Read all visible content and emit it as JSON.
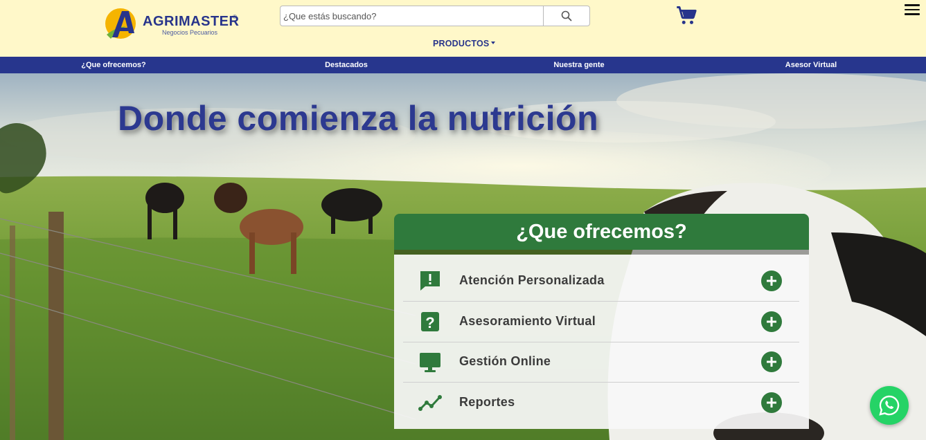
{
  "header": {
    "logo_text": "AGRIMASTER",
    "logo_registered": "®",
    "logo_sub": "Negocios Pecuarios",
    "search_placeholder": "¿Que estás buscando?",
    "productos_label": "PRODUCTOS"
  },
  "nav": {
    "items": [
      {
        "label": "¿Que ofrecemos?"
      },
      {
        "label": "Destacados"
      },
      {
        "label": "Nuestra gente"
      },
      {
        "label": "Asesor Virtual"
      }
    ]
  },
  "hero": {
    "title": "Donde comienza la nutrición"
  },
  "offer": {
    "title": "¿Que ofrecemos?",
    "items": [
      {
        "label": "Atención Personalizada",
        "icon": "chat-alert-icon"
      },
      {
        "label": "Asesoramiento Virtual",
        "icon": "question-square-icon"
      },
      {
        "label": "Gestión Online",
        "icon": "monitor-icon"
      },
      {
        "label": "Reportes",
        "icon": "line-chart-icon"
      }
    ]
  },
  "colors": {
    "header_bg": "#fff8c9",
    "nav_bg": "#27368d",
    "brand_blue": "#2c3990",
    "accent_green": "#2f7a3c",
    "whatsapp_green": "#25d366"
  }
}
